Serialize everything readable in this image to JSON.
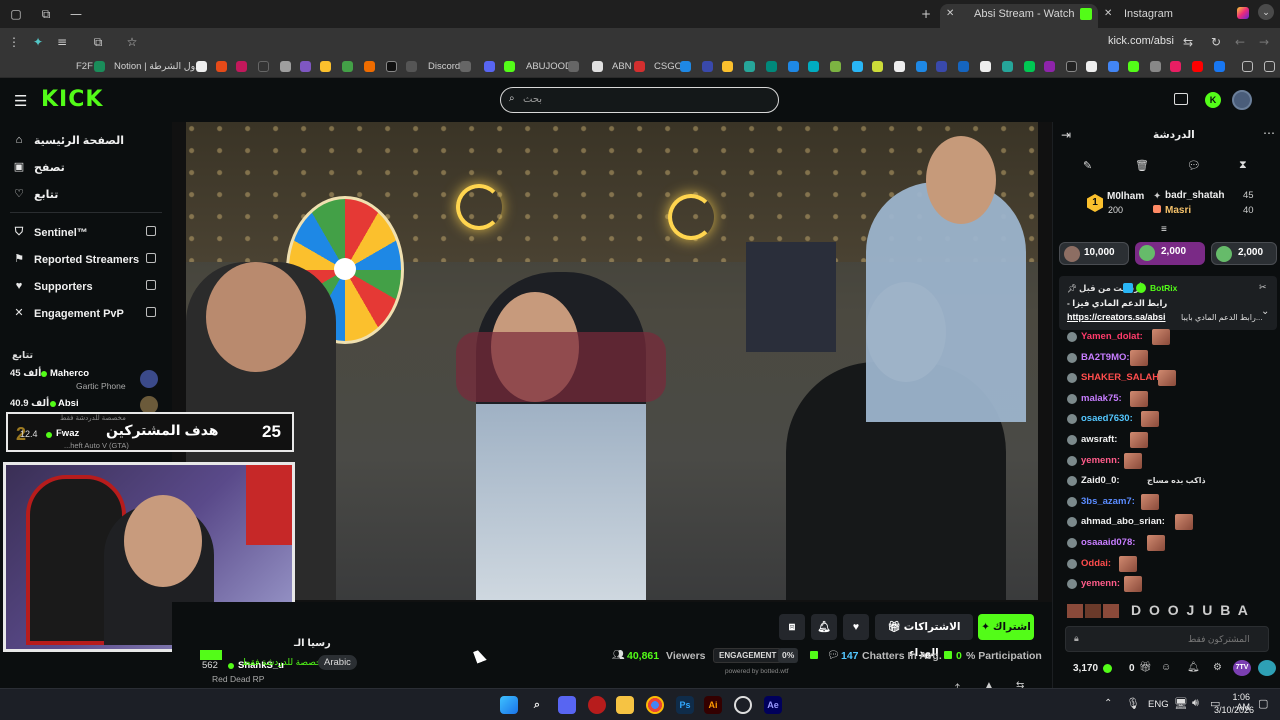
{
  "browser": {
    "tabs": [
      {
        "title": "Absi Stream - Watch Live on Kick",
        "active": true
      },
      {
        "title": "Instagram",
        "active": false
      }
    ],
    "url": "kick.com/absi",
    "bookmarks": [
      "F2F",
      "Notion | جدول الشرطة",
      "Discord",
      "ABUJOOD",
      "ABN",
      "CSGO"
    ]
  },
  "header": {
    "logo": "KICK",
    "search_placeholder": "بحث"
  },
  "sidebar": {
    "nav": [
      {
        "label": "الصفحة الرئيسية",
        "icon": "home-icon"
      },
      {
        "label": "تصفح",
        "icon": "browse-icon"
      },
      {
        "label": "تتابع",
        "icon": "heart-icon"
      }
    ],
    "extensions": [
      {
        "label": "Sentinel™",
        "icon": "shield-icon"
      },
      {
        "label": "Reported Streamers",
        "icon": "flag-icon"
      },
      {
        "label": "Supporters",
        "icon": "heart-icon"
      },
      {
        "label": "Engagement PvP",
        "icon": "swords-icon"
      }
    ],
    "following_title": "تتابع",
    "following": [
      {
        "name": "Maherco",
        "viewers": "45 ألف",
        "game": "Gartic Phone"
      },
      {
        "name": "Absi",
        "viewers": "40.9 ألف",
        "game": "مخصصة للدردشة فقط"
      },
      {
        "name": "Fwaz",
        "viewers": "12.4",
        "game": "...heft Auto V (GTA)"
      },
      {
        "name": "ShankS_u",
        "viewers": "562",
        "game": "Red Dead RP"
      }
    ]
  },
  "overlay": {
    "subgoal_label": "هدف المشتركين",
    "subgoal_count": "25"
  },
  "stream": {
    "title_partial": "رسيا الـ",
    "category": "مخصصة للدردشة فقط",
    "language": "Arabic",
    "buttons": {
      "subscribe": "اشتراك",
      "gift": "الاشتراكات الهداء"
    },
    "stats": {
      "viewers": "40,861",
      "viewers_label": "Viewers",
      "engagement_label": "ENGAGEMENT",
      "engagement_value": "0%",
      "chatters": "147",
      "chatters_label": "Chatters In Avg.",
      "participation": "0",
      "participation_label": "% Participation",
      "powered_by": "powered by botted.wtf"
    }
  },
  "chat": {
    "title": "الدردشة",
    "leaderboard": [
      {
        "name": "M0lham",
        "value": "200"
      },
      {
        "name": "badr_shatah",
        "value": "45"
      },
      {
        "name": "Masri",
        "value": "40"
      }
    ],
    "gift_pills": [
      "10,000",
      "2,000",
      "2,000"
    ],
    "pinned": {
      "pinned_by": "أرسلت من قبل",
      "user": "BotRix",
      "line1": "- رابط الدعم المادي فيزا",
      "link": "https://creators.sa/absi",
      "line2": "رابط الدعم المادي بايبا..."
    },
    "messages": [
      {
        "name": "Yamen_dolat:",
        "color": "#ff3b6b",
        "text": ""
      },
      {
        "name": "BA2T9MO:",
        "color": "#c77dff",
        "text": ""
      },
      {
        "name": "SHAKER_SALAH:",
        "color": "#ff4d4d",
        "text": ""
      },
      {
        "name": "malak75:",
        "color": "#c77dff",
        "text": ""
      },
      {
        "name": "osaed7630:",
        "color": "#53c7ff",
        "text": ""
      },
      {
        "name": "awsraft:",
        "color": "#f0f0f0",
        "text": ""
      },
      {
        "name": "yemenn:",
        "color": "#ff5c8a",
        "text": ""
      },
      {
        "name": "Zaid0_0:",
        "color": "#f0f0f0",
        "text": "ذاكب بده مساج"
      },
      {
        "name": "3bs_azam7:",
        "color": "#5b8cff",
        "text": ""
      },
      {
        "name": "ahmad_abo_srian:",
        "color": "#f0f0f0",
        "text": ""
      },
      {
        "name": "osaaaid078:",
        "color": "#c77dff",
        "text": ""
      },
      {
        "name": "Oddai:",
        "color": "#ff4d4d",
        "text": ""
      },
      {
        "name": "yemenn:",
        "color": "#ff5c8a",
        "text": ""
      }
    ],
    "banner_text": "D O O J U B A",
    "input_placeholder": "المشتركون فقط",
    "points": "3,170",
    "count_zero": "0"
  },
  "taskbar": {
    "lang": "ENG",
    "time": "1:06 AM",
    "date": "3/10/2026"
  }
}
